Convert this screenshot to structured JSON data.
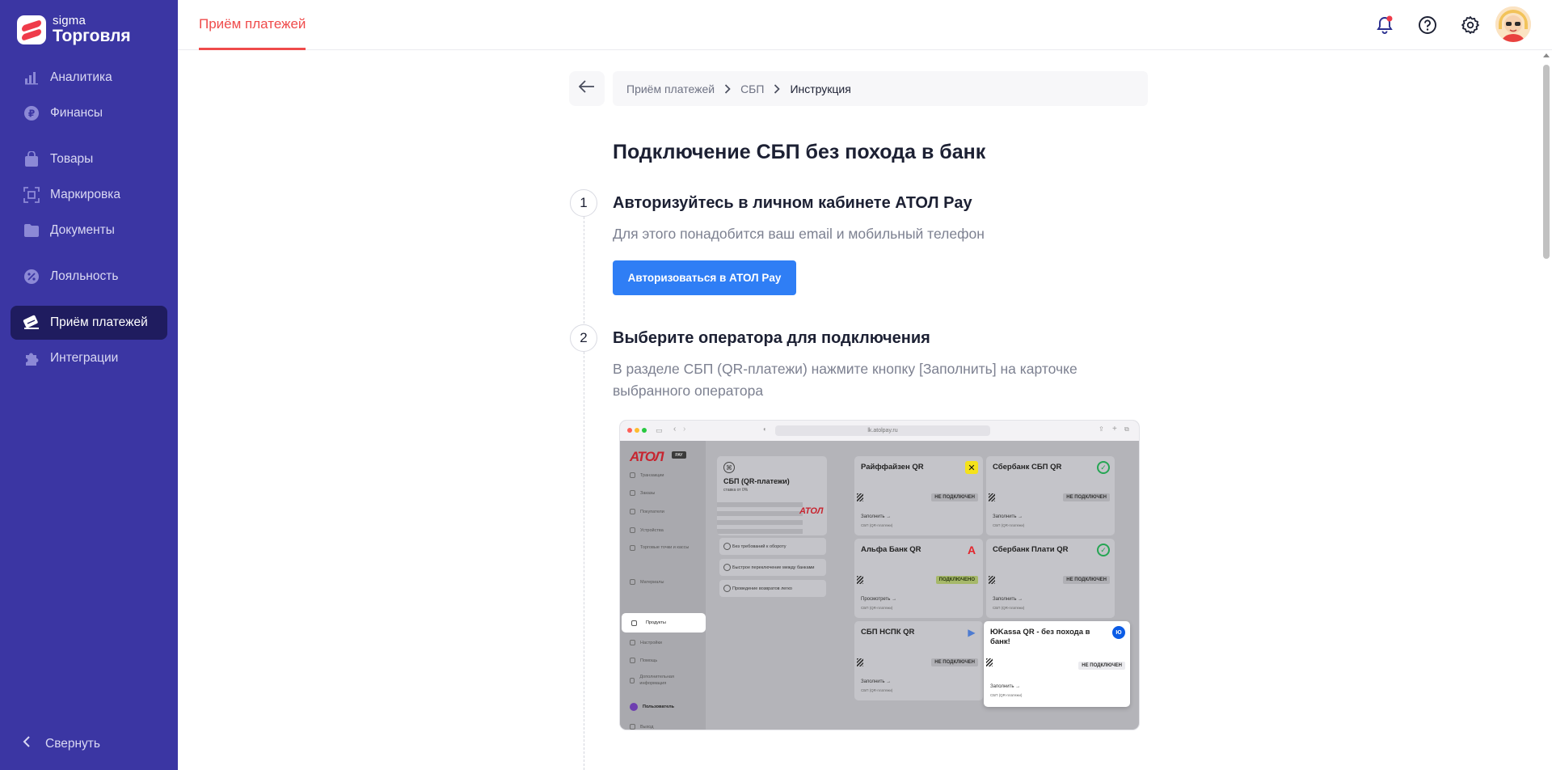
{
  "sidebar": {
    "logo": {
      "sigma": "sigma",
      "name": "Торговля"
    },
    "items": [
      {
        "label": "Аналитика",
        "icon": "bar-chart-icon"
      },
      {
        "label": "Финансы",
        "icon": "ruble-icon"
      },
      {
        "label": "Товары",
        "icon": "shopping-bag-icon"
      },
      {
        "label": "Маркировка",
        "icon": "marking-scan-icon"
      },
      {
        "label": "Документы",
        "icon": "folder-icon"
      },
      {
        "label": "Лояльность",
        "icon": "discount-icon"
      },
      {
        "label": "Приём платежей",
        "icon": "payment-card-icon",
        "active": true
      },
      {
        "label": "Интеграции",
        "icon": "puzzle-icon"
      }
    ],
    "collapse_label": "Свернуть"
  },
  "header": {
    "tab": "Приём платежей",
    "icons": [
      "notification-bell-icon",
      "help-icon",
      "settings-gear-icon"
    ],
    "accent_color": "#ef4b4b"
  },
  "breadcrumb": {
    "items": [
      "Приём платежей",
      "СБП",
      "Инструкция"
    ]
  },
  "page": {
    "title": "Подключение СБП без похода в банк",
    "steps": [
      {
        "number": "1",
        "title": "Авторизуйтесь в личном кабинете АТОЛ Pay",
        "description": "Для этого понадобится ваш email и мобильный телефон",
        "button": "Авторизоваться в АТОЛ Pay"
      },
      {
        "number": "2",
        "title": "Выберите оператора для подключения",
        "description_line1": "В разделе СБП (QR-платежи) нажмите кнопку [Заполнить] на карточке",
        "description_line2": "выбранного оператора"
      }
    ]
  },
  "screenshot": {
    "url": "lk.atolpay.ru",
    "brand": "АТОЛ",
    "brand_badge": "PAY",
    "side_items": [
      "Транзакции",
      "Заказы",
      "Покупатели",
      "Устройства",
      "Торговые точки и кассы",
      "Материалы",
      "Продукты",
      "Настройки",
      "Помощь",
      "Дополнительная информация",
      "Пользователь",
      "Выход"
    ],
    "hero": {
      "title": "СБП (QR-платежи)",
      "subtitle": "ставка от 0%"
    },
    "features": [
      "Без требований к обороту",
      "Быстрое переключение между банками",
      "Проведение возвратов легко"
    ],
    "cards": [
      {
        "title": "Райффайзен QR",
        "status": "НЕ ПОДКЛЮЧЕН",
        "link": "Заполнить →",
        "sub": "СБП (QR-платежи)"
      },
      {
        "title": "Сбербанк СБП QR",
        "status": "НЕ ПОДКЛЮЧЕН",
        "link": "Заполнить →",
        "sub": "СБП (QR-платежи)"
      },
      {
        "title": "Альфа Банк QR",
        "status": "ПОДКЛЮЧЕНО",
        "link": "Просмотреть →",
        "sub": "СБП (QR-платежи)"
      },
      {
        "title": "Сбербанк Плати QR",
        "status": "НЕ ПОДКЛЮЧЕН",
        "link": "Заполнить →",
        "sub": "СБП (QR-платежи)"
      },
      {
        "title": "СБП НСПК QR",
        "status": "НЕ ПОДКЛЮЧЕН",
        "link": "Заполнить →",
        "sub": "СБП (QR-платежи)"
      },
      {
        "title": "ЮKassa QR - без похода в банк!",
        "status": "НЕ ПОДКЛЮЧЕН",
        "link": "Заполнить →",
        "sub": "СБП (QR-платежи)"
      }
    ]
  }
}
